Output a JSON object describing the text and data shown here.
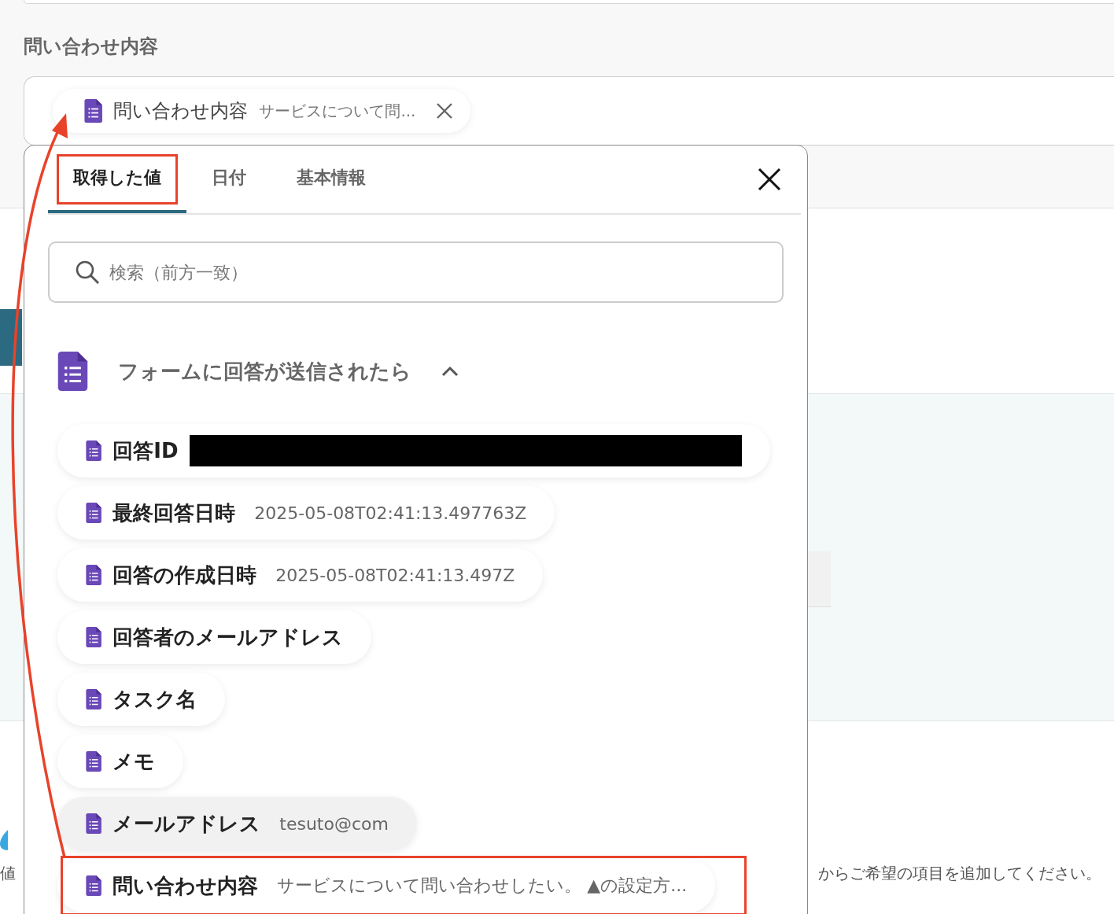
{
  "field": {
    "label": "問い合わせ内容",
    "chip": {
      "name": "問い合わせ内容",
      "value": "サービスについて問..."
    }
  },
  "popup": {
    "tabs": [
      {
        "label": "取得した値",
        "selected": true,
        "annotated": true
      },
      {
        "label": "日付",
        "selected": false,
        "annotated": false
      },
      {
        "label": "基本情報",
        "selected": false,
        "annotated": false
      }
    ],
    "search": {
      "placeholder": "検索（前方一致）"
    },
    "section": {
      "title": "フォームに回答が送信されたら",
      "expanded": true
    },
    "items": [
      {
        "name": "回答ID",
        "redacted": true,
        "hovered": false,
        "annotated": false
      },
      {
        "name": "最終回答日時",
        "value": "2025-05-08T02:41:13.497763Z",
        "hovered": false,
        "annotated": false
      },
      {
        "name": "回答の作成日時",
        "value": "2025-05-08T02:41:13.497Z",
        "hovered": false,
        "annotated": false
      },
      {
        "name": "回答者のメールアドレス",
        "hovered": false,
        "annotated": false
      },
      {
        "name": "タスク名",
        "hovered": false,
        "annotated": false
      },
      {
        "name": "メモ",
        "hovered": false,
        "annotated": false
      },
      {
        "name": "メールアドレス",
        "value": "tesuto@com",
        "hovered": true,
        "annotated": false
      },
      {
        "name": "問い合わせ内容",
        "value": "サービスについて問い合わせしたい。 ▲の設定方...",
        "hovered": false,
        "annotated": true
      }
    ]
  },
  "arrow": true,
  "background": {
    "left_text": "値",
    "right_text": "からご希望の項目を追加してください。"
  }
}
